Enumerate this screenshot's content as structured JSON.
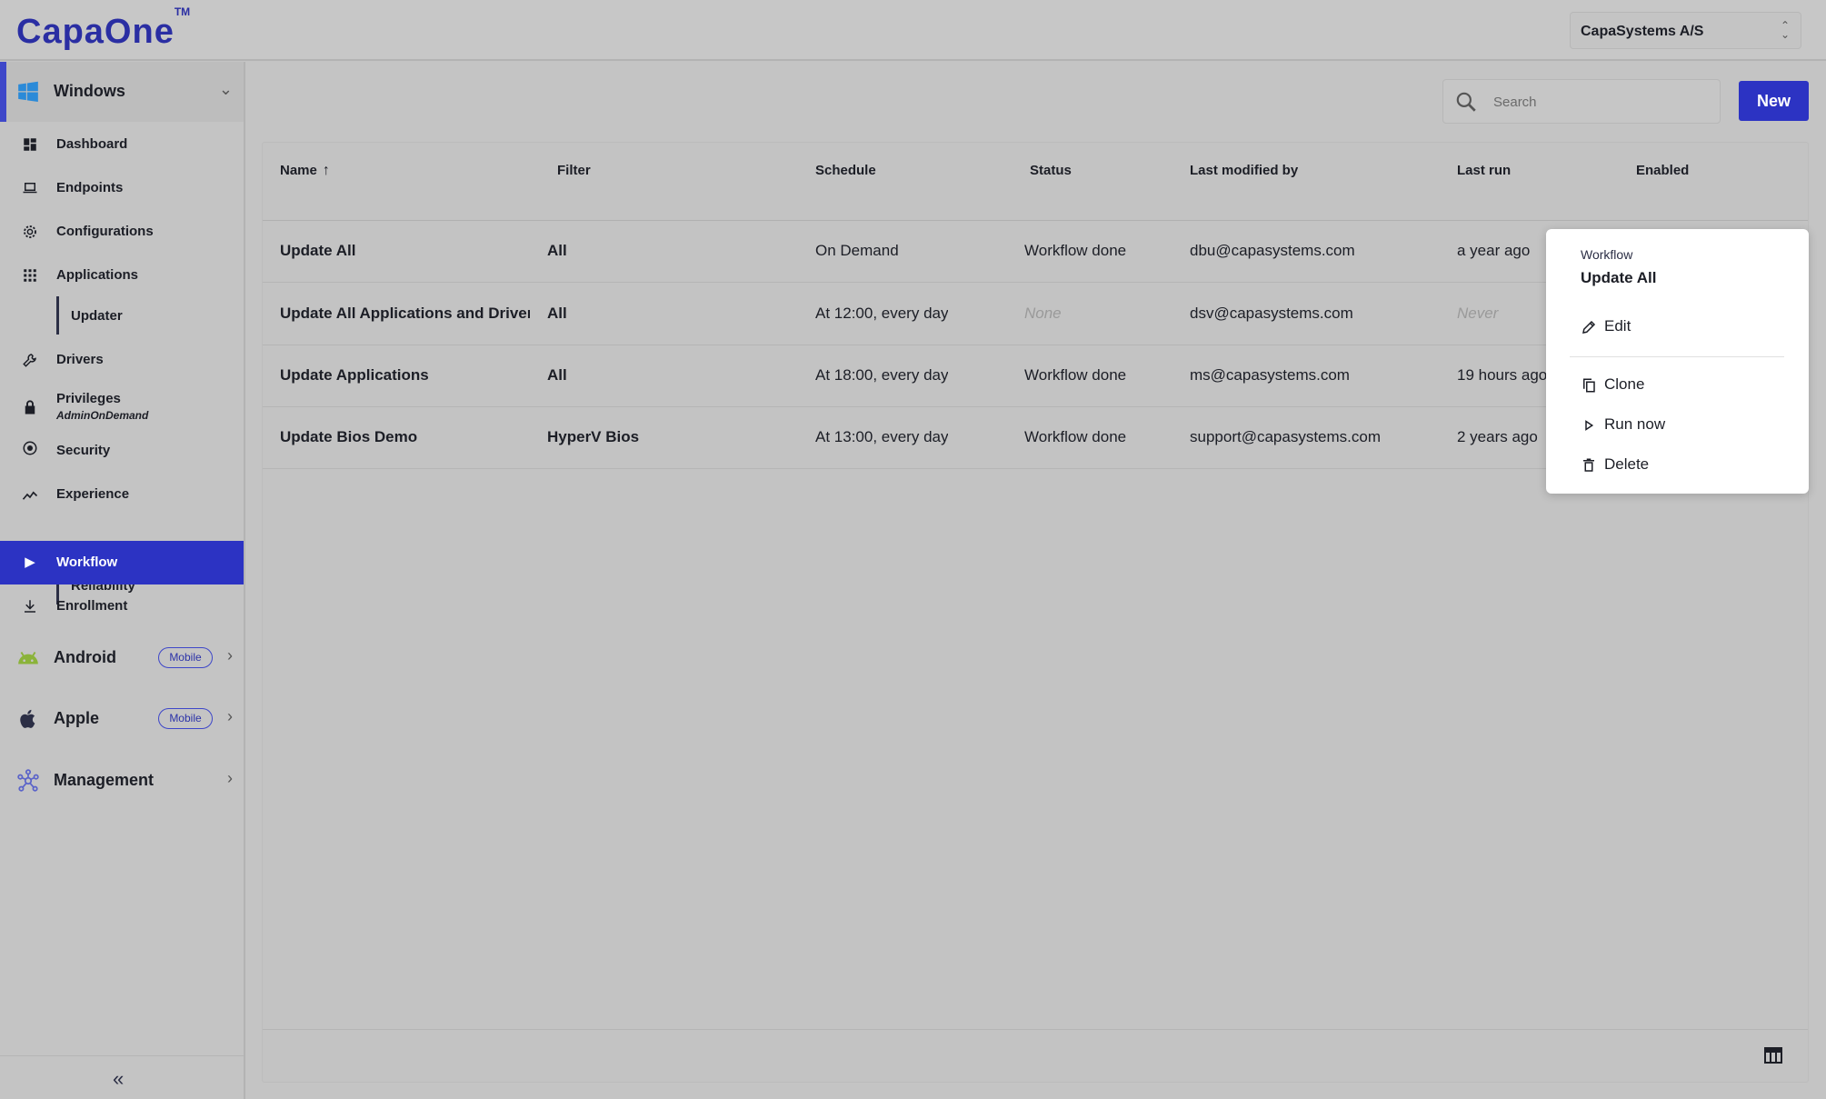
{
  "app": {
    "logo": "CapaOne",
    "logo_tm": "TM"
  },
  "org_selector": {
    "value": "CapaSystems A/S"
  },
  "sidebar": {
    "windows": {
      "label": "Windows"
    },
    "items": [
      {
        "label": "Dashboard"
      },
      {
        "label": "Endpoints"
      },
      {
        "label": "Configurations"
      },
      {
        "label": "Applications"
      },
      {
        "label": "Updater"
      },
      {
        "label": "Drivers"
      },
      {
        "label": "Privileges",
        "sub": "AdminOnDemand"
      },
      {
        "label": "Security"
      },
      {
        "label": "Experience"
      },
      {
        "label": "Reliability"
      },
      {
        "label": "Workflow"
      },
      {
        "label": "Enrollment"
      }
    ],
    "android": {
      "label": "Android",
      "badge": "Mobile"
    },
    "apple": {
      "label": "Apple",
      "badge": "Mobile"
    },
    "management": {
      "label": "Management"
    },
    "collapse_glyph": "«"
  },
  "toolbar": {
    "search_placeholder": "Search",
    "new_label": "New"
  },
  "table": {
    "columns": [
      "Name",
      "Filter",
      "Schedule",
      "Status",
      "Last modified by",
      "Last run",
      "Enabled"
    ],
    "rows": [
      {
        "name": "Update All",
        "filter": "All",
        "schedule": "On Demand",
        "status": "Workflow done",
        "modified_by": "dbu@capasystems.com",
        "last_run": "a year ago"
      },
      {
        "name": "Update All Applications and Drivers",
        "filter": "All",
        "schedule": "At 12:00, every day",
        "status": "None",
        "modified_by": "dsv@capasystems.com",
        "last_run": "Never"
      },
      {
        "name": "Update Applications",
        "filter": "All",
        "schedule": "At 18:00, every day",
        "status": "Workflow done",
        "modified_by": "ms@capasystems.com",
        "last_run": "19 hours ago"
      },
      {
        "name": "Update Bios Demo",
        "filter": "HyperV Bios",
        "schedule": "At 13:00, every day",
        "status": "Workflow done",
        "modified_by": "support@capasystems.com",
        "last_run": "2 years ago"
      }
    ]
  },
  "context_menu": {
    "caption": "Workflow",
    "title": "Update All",
    "items": [
      {
        "label": "Edit",
        "icon": "pencil-icon"
      },
      {
        "label": "Clone",
        "icon": "copy-icon"
      },
      {
        "label": "Run now",
        "icon": "play-icon"
      },
      {
        "label": "Delete",
        "icon": "trash-icon"
      }
    ]
  },
  "colors": {
    "accent": "#2c33c3",
    "brand": "#2a2ea3",
    "android": "#8bb33a"
  }
}
